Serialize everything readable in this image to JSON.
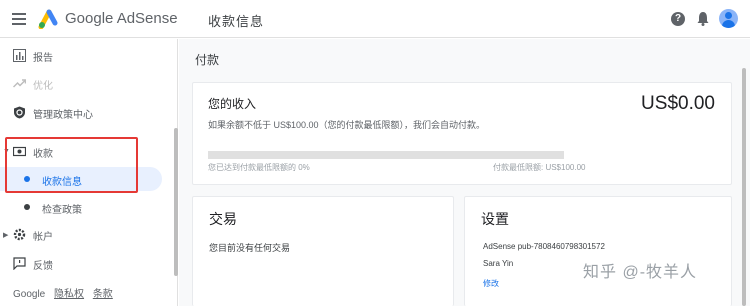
{
  "header": {
    "brand": "Google AdSense",
    "page_title": "收款信息",
    "help_glyph": "?"
  },
  "sidebar": {
    "items": [
      {
        "label": "报告",
        "icon": "bar-chart-icon"
      },
      {
        "label": "优化",
        "icon": "trend-icon"
      },
      {
        "label": "管理政策中心",
        "icon": "shield-icon"
      },
      {
        "label": "收款",
        "icon": "payments-icon",
        "expander": "▼"
      },
      {
        "label": "帐户",
        "icon": "gear-icon",
        "expander": "▶"
      },
      {
        "label": "反馈",
        "icon": "feedback-icon"
      }
    ],
    "sub_items": [
      {
        "label": "收款信息",
        "active": true
      },
      {
        "label": "检查政策",
        "active": false
      }
    ],
    "footer": {
      "google": "Google",
      "privacy": "隐私权",
      "terms": "条款"
    }
  },
  "main": {
    "section_title": "付款",
    "balance": {
      "title": "您的收入",
      "amount": "US$0.00",
      "note": "如果余额不低于 US$100.00（您的付款最低限额），我们会自动付款。",
      "progress_fraction": 0,
      "progress_left": "您已达到付款最低限额的 0%",
      "progress_right": "付款最低限额: US$100.00"
    },
    "transactions": {
      "title": "交易",
      "text": "您目前没有任何交易"
    },
    "settings": {
      "title": "设置",
      "publisher_id": "AdSense pub-7808460798301572",
      "name": "Sara Yin",
      "link": "修改"
    }
  },
  "watermark": "知乎 @-牧羊人",
  "colors": {
    "accent": "#1a73e8",
    "annotation": "#e53935"
  }
}
